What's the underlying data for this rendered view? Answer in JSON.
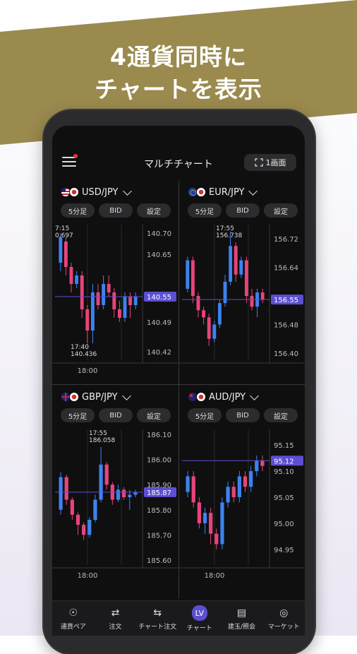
{
  "headline": {
    "line1": "4通貨同時に",
    "line2": "チャートを表示"
  },
  "app": {
    "title": "マルチチャート",
    "one_screen_label": "1画面",
    "icons": {
      "menu": "hamburger-icon",
      "expand": "expand-icon"
    },
    "accent": "#5c4fd1",
    "up_color": "#3d82f0",
    "down_color": "#e8447a"
  },
  "panels": [
    {
      "pair": "USD/JPY",
      "flags": [
        "us",
        "jp"
      ],
      "buttons": [
        "5分足",
        "BID",
        "設定"
      ],
      "y_ticks": [
        "140.70",
        "140.65",
        "140.55",
        "140.49",
        "140.42"
      ],
      "current": "140.55",
      "high_label": [
        "7:15",
        "0.697"
      ],
      "low_label": [
        "17:40",
        "140.436"
      ],
      "x_label": "18:00",
      "chart_data": {
        "type": "candlestick",
        "pair": "USD/JPY",
        "ylim": [
          140.4,
          140.72
        ],
        "current_price": 140.55,
        "x_tick": "18:00",
        "candles": [
          {
            "o": 140.63,
            "c": 140.69,
            "h": 140.7,
            "l": 140.61
          },
          {
            "o": 140.68,
            "c": 140.62,
            "h": 140.69,
            "l": 140.6
          },
          {
            "o": 140.62,
            "c": 140.58,
            "h": 140.63,
            "l": 140.56
          },
          {
            "o": 140.58,
            "c": 140.6,
            "h": 140.61,
            "l": 140.57
          },
          {
            "o": 140.6,
            "c": 140.52,
            "h": 140.61,
            "l": 140.5
          },
          {
            "o": 140.52,
            "c": 140.47,
            "h": 140.53,
            "l": 140.44
          },
          {
            "o": 140.47,
            "c": 140.56,
            "h": 140.58,
            "l": 140.44
          },
          {
            "o": 140.56,
            "c": 140.53,
            "h": 140.58,
            "l": 140.52
          },
          {
            "o": 140.53,
            "c": 140.58,
            "h": 140.6,
            "l": 140.52
          },
          {
            "o": 140.58,
            "c": 140.56,
            "h": 140.6,
            "l": 140.55
          },
          {
            "o": 140.56,
            "c": 140.52,
            "h": 140.57,
            "l": 140.5
          },
          {
            "o": 140.52,
            "c": 140.5,
            "h": 140.54,
            "l": 140.49
          },
          {
            "o": 140.5,
            "c": 140.55,
            "h": 140.56,
            "l": 140.49
          },
          {
            "o": 140.55,
            "c": 140.53,
            "h": 140.56,
            "l": 140.5
          },
          {
            "o": 140.53,
            "c": 140.55,
            "h": 140.56,
            "l": 140.52
          }
        ]
      }
    },
    {
      "pair": "EUR/JPY",
      "flags": [
        "eu",
        "jp"
      ],
      "buttons": [
        "5分足",
        "BID",
        "設定"
      ],
      "y_ticks": [
        "156.72",
        "156.64",
        "156.55",
        "156.48",
        "156.40"
      ],
      "current": "156.55",
      "high_label": [
        "17:55",
        "156.738"
      ],
      "low_label": [],
      "x_label": "",
      "chart_data": {
        "type": "candlestick",
        "pair": "EUR/JPY",
        "ylim": [
          156.38,
          156.76
        ],
        "current_price": 156.55,
        "candles": [
          {
            "o": 156.58,
            "c": 156.66,
            "h": 156.67,
            "l": 156.57
          },
          {
            "o": 156.66,
            "c": 156.56,
            "h": 156.67,
            "l": 156.54
          },
          {
            "o": 156.56,
            "c": 156.52,
            "h": 156.57,
            "l": 156.5
          },
          {
            "o": 156.52,
            "c": 156.5,
            "h": 156.53,
            "l": 156.48
          },
          {
            "o": 156.5,
            "c": 156.44,
            "h": 156.51,
            "l": 156.42
          },
          {
            "o": 156.44,
            "c": 156.48,
            "h": 156.49,
            "l": 156.43
          },
          {
            "o": 156.48,
            "c": 156.54,
            "h": 156.55,
            "l": 156.47
          },
          {
            "o": 156.54,
            "c": 156.6,
            "h": 156.62,
            "l": 156.53
          },
          {
            "o": 156.6,
            "c": 156.7,
            "h": 156.74,
            "l": 156.59
          },
          {
            "o": 156.7,
            "c": 156.62,
            "h": 156.71,
            "l": 156.6
          },
          {
            "o": 156.62,
            "c": 156.66,
            "h": 156.67,
            "l": 156.61
          },
          {
            "o": 156.66,
            "c": 156.56,
            "h": 156.67,
            "l": 156.54
          },
          {
            "o": 156.56,
            "c": 156.53,
            "h": 156.58,
            "l": 156.52
          },
          {
            "o": 156.53,
            "c": 156.57,
            "h": 156.58,
            "l": 156.5
          },
          {
            "o": 156.57,
            "c": 156.55,
            "h": 156.58,
            "l": 156.54
          }
        ]
      }
    },
    {
      "pair": "GBP/JPY",
      "flags": [
        "gb",
        "jp"
      ],
      "buttons": [
        "5分足",
        "BID",
        "設定"
      ],
      "y_ticks": [
        "186.10",
        "186.00",
        "185.90",
        "185.87",
        "185.80",
        "185.70",
        "185.60"
      ],
      "current": "185.87",
      "high_label": [
        "17:55",
        "186.058"
      ],
      "low_label": [],
      "x_label": "18:00",
      "chart_data": {
        "type": "candlestick",
        "pair": "GBP/JPY",
        "ylim": [
          185.58,
          186.12
        ],
        "current_price": 185.87,
        "x_tick": "18:00",
        "candles": [
          {
            "o": 185.8,
            "c": 185.93,
            "h": 185.95,
            "l": 185.78
          },
          {
            "o": 185.93,
            "c": 185.84,
            "h": 185.94,
            "l": 185.82
          },
          {
            "o": 185.84,
            "c": 185.78,
            "h": 185.85,
            "l": 185.76
          },
          {
            "o": 185.78,
            "c": 185.74,
            "h": 185.79,
            "l": 185.7
          },
          {
            "o": 185.74,
            "c": 185.7,
            "h": 185.75,
            "l": 185.68
          },
          {
            "o": 185.7,
            "c": 185.76,
            "h": 185.77,
            "l": 185.69
          },
          {
            "o": 185.76,
            "c": 185.84,
            "h": 185.86,
            "l": 185.75
          },
          {
            "o": 185.84,
            "c": 185.98,
            "h": 186.05,
            "l": 185.83
          },
          {
            "o": 185.98,
            "c": 185.9,
            "h": 185.99,
            "l": 185.88
          },
          {
            "o": 185.9,
            "c": 185.84,
            "h": 185.91,
            "l": 185.82
          },
          {
            "o": 185.84,
            "c": 185.88,
            "h": 185.9,
            "l": 185.83
          },
          {
            "o": 185.88,
            "c": 185.85,
            "h": 185.89,
            "l": 185.84
          },
          {
            "o": 185.85,
            "c": 185.86,
            "h": 185.88,
            "l": 185.8
          },
          {
            "o": 185.86,
            "c": 185.87,
            "h": 185.88,
            "l": 185.85
          }
        ]
      }
    },
    {
      "pair": "AUD/JPY",
      "flags": [
        "au",
        "jp"
      ],
      "buttons": [
        "5分足",
        "BID",
        "設定"
      ],
      "y_ticks": [
        "95.15",
        "95.12",
        "95.10",
        "95.05",
        "95.00",
        "94.95"
      ],
      "current": "95.12",
      "high_label": [],
      "low_label": [],
      "x_label": "18:00",
      "chart_data": {
        "type": "candlestick",
        "pair": "AUD/JPY",
        "ylim": [
          94.92,
          95.18
        ],
        "current_price": 95.12,
        "x_tick": "18:00",
        "candles": [
          {
            "o": 95.06,
            "c": 95.09,
            "h": 95.1,
            "l": 95.05
          },
          {
            "o": 95.09,
            "c": 95.04,
            "h": 95.1,
            "l": 95.03
          },
          {
            "o": 95.04,
            "c": 95.0,
            "h": 95.05,
            "l": 94.99
          },
          {
            "o": 95.0,
            "c": 95.02,
            "h": 95.03,
            "l": 94.98
          },
          {
            "o": 95.02,
            "c": 94.98,
            "h": 95.03,
            "l": 94.96
          },
          {
            "o": 94.98,
            "c": 94.96,
            "h": 94.99,
            "l": 94.95
          },
          {
            "o": 94.96,
            "c": 95.04,
            "h": 95.05,
            "l": 94.95
          },
          {
            "o": 95.04,
            "c": 95.07,
            "h": 95.08,
            "l": 95.03
          },
          {
            "o": 95.07,
            "c": 95.05,
            "h": 95.08,
            "l": 95.04
          },
          {
            "o": 95.05,
            "c": 95.09,
            "h": 95.1,
            "l": 95.04
          },
          {
            "o": 95.09,
            "c": 95.07,
            "h": 95.1,
            "l": 95.06
          },
          {
            "o": 95.07,
            "c": 95.1,
            "h": 95.11,
            "l": 95.06
          },
          {
            "o": 95.1,
            "c": 95.12,
            "h": 95.13,
            "l": 95.09
          },
          {
            "o": 95.12,
            "c": 95.11,
            "h": 95.13,
            "l": 95.1
          }
        ]
      }
    }
  ],
  "tabs": [
    {
      "label": "通貨ペア",
      "icon": "currency-pair-icon",
      "active": false
    },
    {
      "label": "注文",
      "icon": "order-icon",
      "active": false
    },
    {
      "label": "チャート注文",
      "icon": "chart-order-icon",
      "active": false
    },
    {
      "label": "チャート",
      "icon": "chart-icon",
      "active": true
    },
    {
      "label": "建玉/照会",
      "icon": "position-icon",
      "active": false
    },
    {
      "label": "マーケット",
      "icon": "market-icon",
      "active": false
    }
  ]
}
